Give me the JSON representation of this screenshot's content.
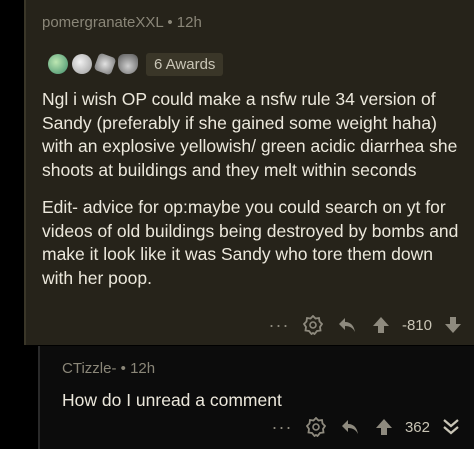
{
  "comment": {
    "author": "pomergranateXXL",
    "separator": "•",
    "age": "12h",
    "awards_label": "6 Awards",
    "paragraphs": [
      "Ngl i wish OP could make a nsfw rule 34 version of Sandy (preferably if she gained some weight haha) with an explosive yellowish/ green acidic diarrhea she shoots at buildings and they melt within seconds",
      "Edit- advice for op:maybe you could search on yt for videos of old buildings being destroyed by bombs and make it  look like it was Sandy who tore them down with her poop."
    ],
    "score": "-810",
    "more_icon": "ellipsis-icon",
    "award_icon": "award-badge-icon",
    "reply_icon": "reply-arrow-icon",
    "upvote_icon": "upvote-arrow-icon",
    "downvote_icon": "downvote-arrow-icon"
  },
  "reply": {
    "author": "CTizzle-",
    "separator": "•",
    "age": "12h",
    "text": "How do I unread a comment",
    "score": "362",
    "collapse_icon": "double-chevron-down-icon"
  },
  "colors": {
    "highlight_bg": "#26231a",
    "page_bg": "#000000",
    "text": "#ece8dc",
    "muted": "#8a8678"
  }
}
